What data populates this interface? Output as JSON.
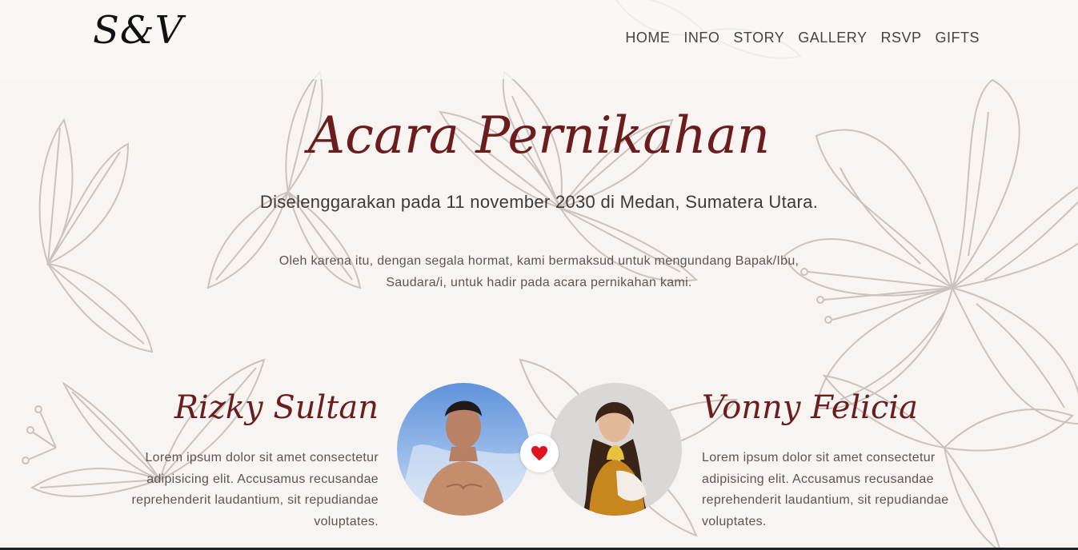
{
  "header": {
    "logo": "S&V",
    "nav": [
      "HOME",
      "INFO",
      "STORY",
      "GALLERY",
      "RSVP",
      "GIFTS"
    ]
  },
  "event": {
    "title": "Acara Pernikahan",
    "subtitle": "Diselenggarakan pada 11 november 2030 di Medan, Sumatera Utara.",
    "intro": "Oleh karena itu, dengan segala hormat, kami bermaksud untuk mengundang Bapak/Ibu, Saudara/i, untuk hadir pada acara pernikahan kami."
  },
  "couple": {
    "groom": {
      "name": "Rizky Sultan",
      "bio": "Lorem ipsum dolor sit amet consectetur adipisicing elit. Accusamus recusandae reprehenderit laudantium, sit repudiandae voluptates."
    },
    "bride": {
      "name": "Vonny Felicia",
      "bio": "Lorem ipsum dolor sit amet consectetur adipisicing elit. Accusamus recusandae reprehenderit laudantium, sit repudiandae voluptates."
    },
    "divider_icon": "heart-icon"
  },
  "colors": {
    "background": "#f7f4f1",
    "accent": "#6b1d1e",
    "heart": "#e0141e",
    "floral_line": "#c6c0bb"
  }
}
